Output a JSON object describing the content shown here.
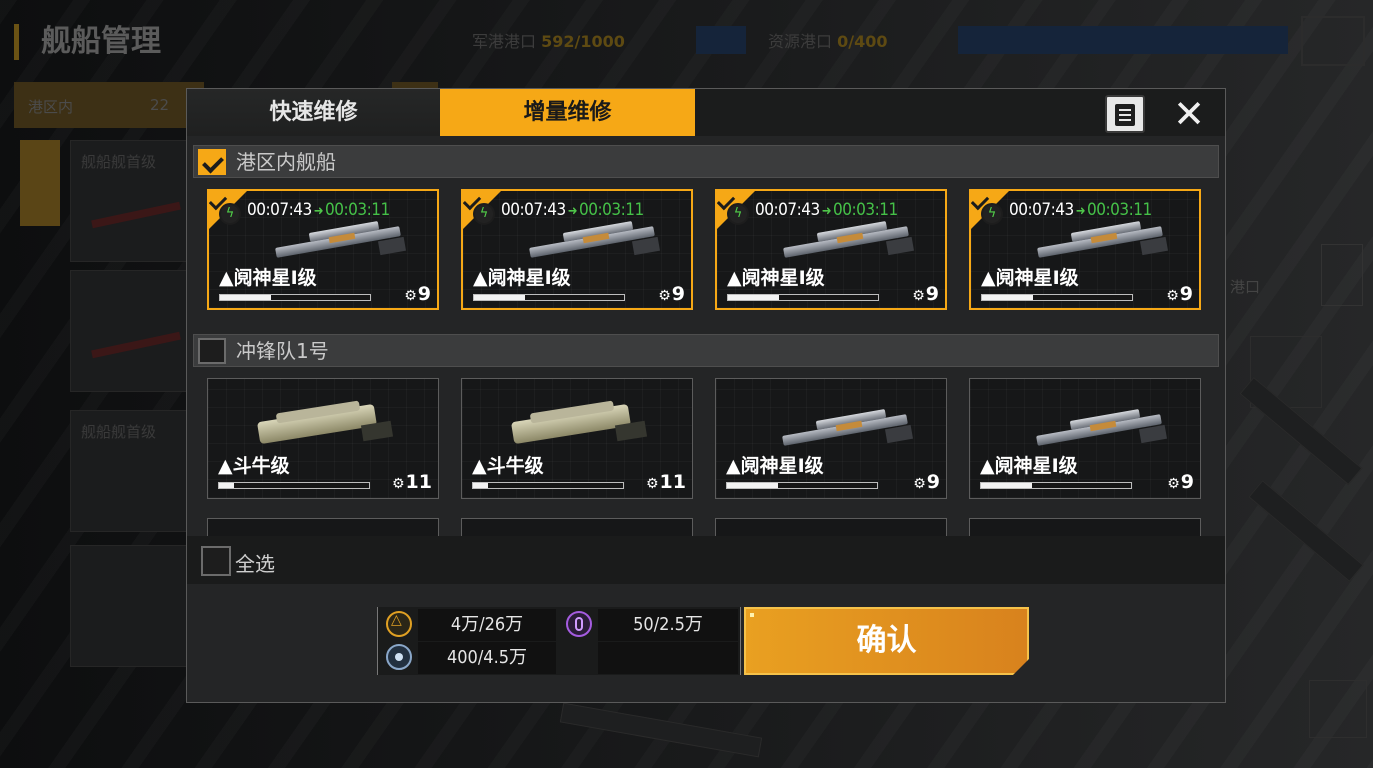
{
  "background": {
    "title": "舰船管理",
    "resource_1": {
      "label": "军港港口",
      "value": "592/1000"
    },
    "resource_2": {
      "label": "资源港口",
      "value": "0/400"
    },
    "tab_label": "港区内",
    "tab_value": "22",
    "card_1_text": "舰船舰首级",
    "card_2_text": "舰船舰首级",
    "right_text": "港口"
  },
  "modal": {
    "tabs": [
      {
        "label": "快速维修",
        "active": false
      },
      {
        "label": "增量维修",
        "active": true
      }
    ],
    "notes_icon": "document-icon",
    "close_icon": "close-icon",
    "close_glyph": "✕",
    "sections": [
      {
        "label": "港区内舰船",
        "checked": true,
        "ships": [
          {
            "name": "▲阋神星Ⅰ级",
            "level": "9",
            "hp_pct": 34,
            "selected": true,
            "timer_old": "00:07:43",
            "timer_new": "00:03:11",
            "type": "cruiser"
          },
          {
            "name": "▲阋神星Ⅰ级",
            "level": "9",
            "hp_pct": 34,
            "selected": true,
            "timer_old": "00:07:43",
            "timer_new": "00:03:11",
            "type": "cruiser"
          },
          {
            "name": "▲阋神星Ⅰ级",
            "level": "9",
            "hp_pct": 34,
            "selected": true,
            "timer_old": "00:07:43",
            "timer_new": "00:03:11",
            "type": "cruiser"
          },
          {
            "name": "▲阋神星Ⅰ级",
            "level": "9",
            "hp_pct": 34,
            "selected": true,
            "timer_old": "00:07:43",
            "timer_new": "00:03:11",
            "type": "cruiser"
          }
        ]
      },
      {
        "label": "冲锋队1号",
        "checked": false,
        "ships": [
          {
            "name": "▲斗牛级",
            "level": "11",
            "hp_pct": 10,
            "selected": false,
            "type": "bull"
          },
          {
            "name": "▲斗牛级",
            "level": "11",
            "hp_pct": 10,
            "selected": false,
            "type": "bull"
          },
          {
            "name": "▲阋神星Ⅰ级",
            "level": "9",
            "hp_pct": 34,
            "selected": false,
            "type": "cruiser"
          },
          {
            "name": "▲阋神星Ⅰ级",
            "level": "9",
            "hp_pct": 34,
            "selected": false,
            "type": "cruiser"
          }
        ]
      }
    ],
    "scroll_indicator": "chevron-down-icon",
    "scroll_glyph": "︾",
    "select_all": {
      "label": "全选",
      "checked": false
    },
    "costs": {
      "metal": {
        "icon": "metal-icon",
        "value": "4万/26万"
      },
      "gas": {
        "icon": "gas-icon",
        "value": "400/4.5万"
      },
      "crystal": {
        "icon": "crystal-icon",
        "value": "50/2.5万"
      }
    },
    "confirm_label": "确认"
  },
  "colors": {
    "accent": "#f6a816",
    "timer_green": "#45c048",
    "panel": "#242526"
  }
}
